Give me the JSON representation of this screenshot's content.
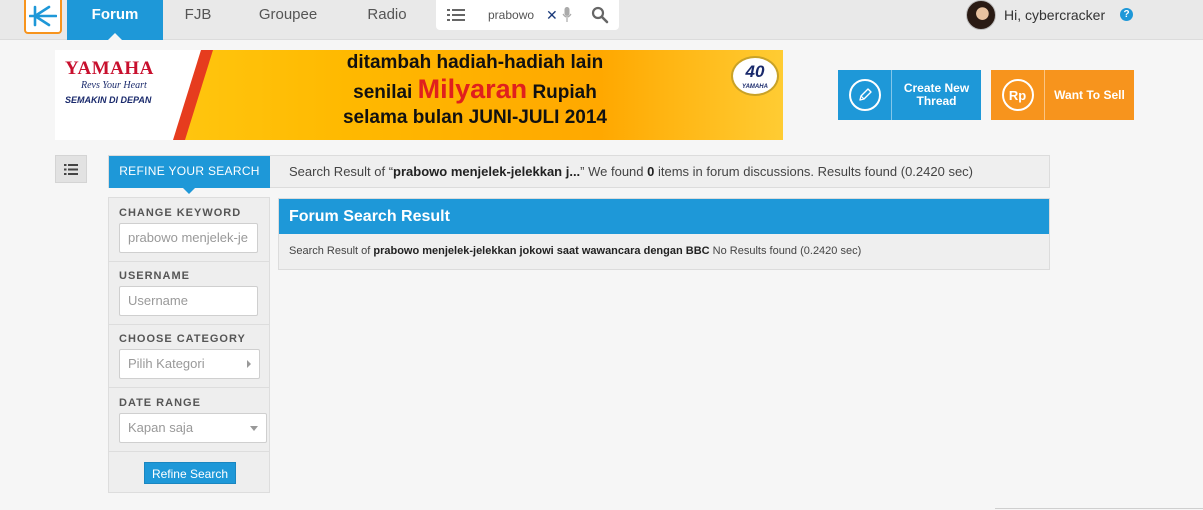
{
  "nav": {
    "items": [
      {
        "label": "Forum"
      },
      {
        "label": "FJB"
      },
      {
        "label": "Groupee"
      },
      {
        "label": "Radio"
      }
    ],
    "search": {
      "value": "prabowo m"
    }
  },
  "user": {
    "greeting": "Hi, cybercracker",
    "help": "?"
  },
  "banner": {
    "brand": "YAMAHA",
    "tagline": "Revs Your Heart",
    "sub": "SEMAKIN DI DEPAN",
    "line1": "ditambah hadiah-hadiah lain",
    "line2_pre": "senilai",
    "line2_hl": "Milyaran",
    "line2_post": "Rupiah",
    "line3_pre": "selama bulan",
    "line3_strong": "JUNI-JULI 2014",
    "badge": "40",
    "badge_sub": "YAMAHA"
  },
  "actions": {
    "create_label": "Create New Thread",
    "sell_label": "Want To Sell",
    "sell_icon": "Rp"
  },
  "result_header": {
    "tab": "REFINE YOUR SEARCH",
    "prefix": "Search Result of “",
    "query": "prabowo menjelek-jelekkan j...",
    "mid": "” We found ",
    "count": "0",
    "suffix": " items in forum discussions. Results found (0.2420 sec)"
  },
  "sidebar": {
    "keyword_label": "CHANGE KEYWORD",
    "keyword_value": "prabowo menjelek-je",
    "username_label": "USERNAME",
    "username_placeholder": "Username",
    "category_label": "CHOOSE CATEGORY",
    "category_value": "Pilih Kategori",
    "date_label": "DATE RANGE",
    "date_value": "Kapan saja",
    "refine_button": "Refine Search"
  },
  "panel": {
    "title": "Forum Search Result",
    "prefix": "Search Result of ",
    "query": "prabowo menjelek-jelekkan jokowi saat wawancara dengan BBC",
    "suffix": " No Results found (0.2420 sec)"
  },
  "colors": {
    "accent": "#1e98d8",
    "orange": "#f7941d",
    "background": "#f6f6f6"
  }
}
